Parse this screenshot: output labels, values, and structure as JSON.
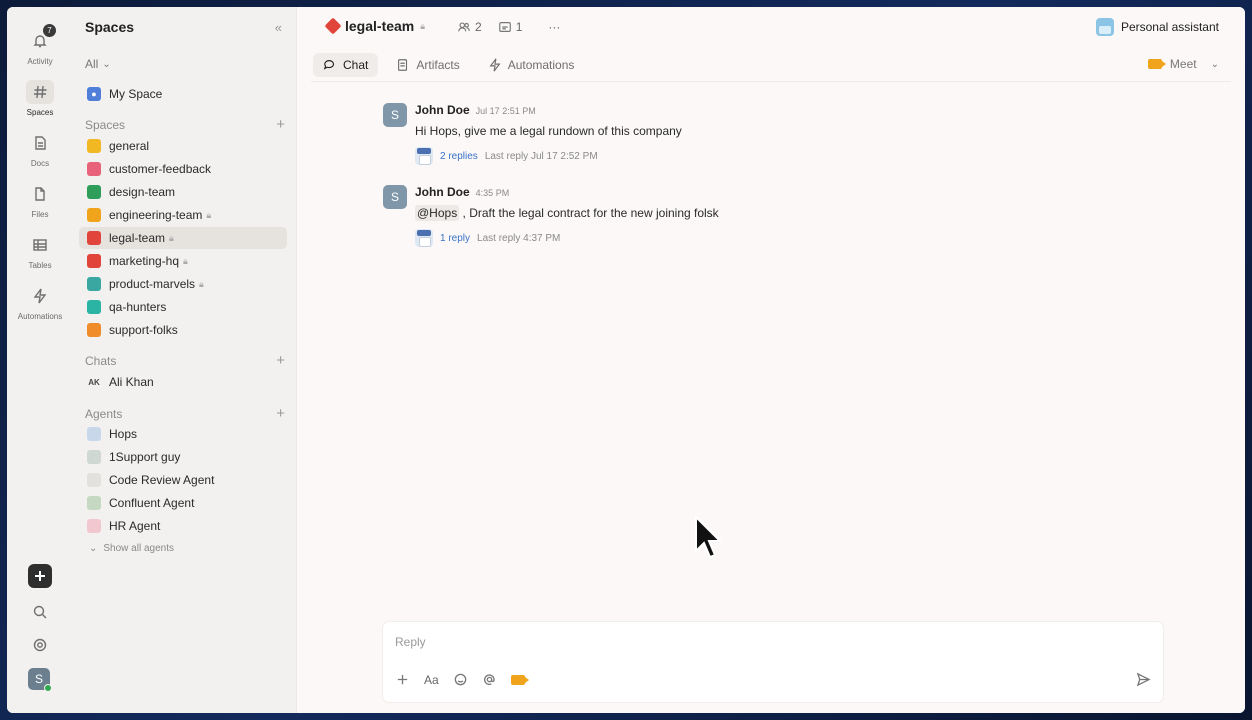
{
  "rail": {
    "activity": {
      "label": "Activity",
      "badge": "7"
    },
    "spaces": {
      "label": "Spaces"
    },
    "docs": {
      "label": "Docs"
    },
    "files": {
      "label": "Files"
    },
    "tables": {
      "label": "Tables"
    },
    "automations": {
      "label": "Automations"
    },
    "user_initial": "S"
  },
  "sidebar": {
    "title": "Spaces",
    "filter": "All",
    "my_space": "My Space",
    "spaces_header": "Spaces",
    "spaces": [
      {
        "label": "general",
        "color": "#f2b824"
      },
      {
        "label": "customer-feedback",
        "color": "#e8627a"
      },
      {
        "label": "design-team",
        "color": "#2f9e5a"
      },
      {
        "label": "engineering-team",
        "color": "#f0a41c"
      },
      {
        "label": "legal-team",
        "color": "#e0443a"
      },
      {
        "label": "marketing-hq",
        "color": "#e0443a"
      },
      {
        "label": "product-marvels",
        "color": "#3aa8a0"
      },
      {
        "label": "qa-hunters",
        "color": "#2bb3a3"
      },
      {
        "label": "support-folks",
        "color": "#f08c2a"
      }
    ],
    "chats_header": "Chats",
    "chats": [
      {
        "initials": "AK",
        "label": "Ali Khan"
      }
    ],
    "agents_header": "Agents",
    "agents": [
      {
        "label": "Hops"
      },
      {
        "label": "1Support guy"
      },
      {
        "label": "Code Review Agent"
      },
      {
        "label": "Confluent Agent"
      },
      {
        "label": "HR Agent"
      }
    ],
    "show_all": "Show all agents"
  },
  "header": {
    "channel": "legal-team",
    "members": "2",
    "pinned": "1",
    "more": "···",
    "personal_assistant": "Personal assistant"
  },
  "tabs": [
    {
      "label": "Chat"
    },
    {
      "label": "Artifacts"
    },
    {
      "label": "Automations"
    }
  ],
  "meet": "Meet",
  "messages": [
    {
      "initial": "S",
      "name": "John Doe",
      "time": "Jul 17 2:51 PM",
      "text": "Hi Hops, give me a legal rundown of this company",
      "reply_count": "2 replies",
      "last_reply": "Last reply Jul 17 2:52 PM"
    },
    {
      "initial": "S",
      "name": "John Doe",
      "time": "4:35 PM",
      "mention": "@Hops",
      "text": ", Draft the legal contract for the new joining folsk",
      "reply_count": "1 reply",
      "last_reply": "Last reply 4:37 PM"
    }
  ],
  "composer": {
    "placeholder": "Reply",
    "format_label": "Aa"
  }
}
